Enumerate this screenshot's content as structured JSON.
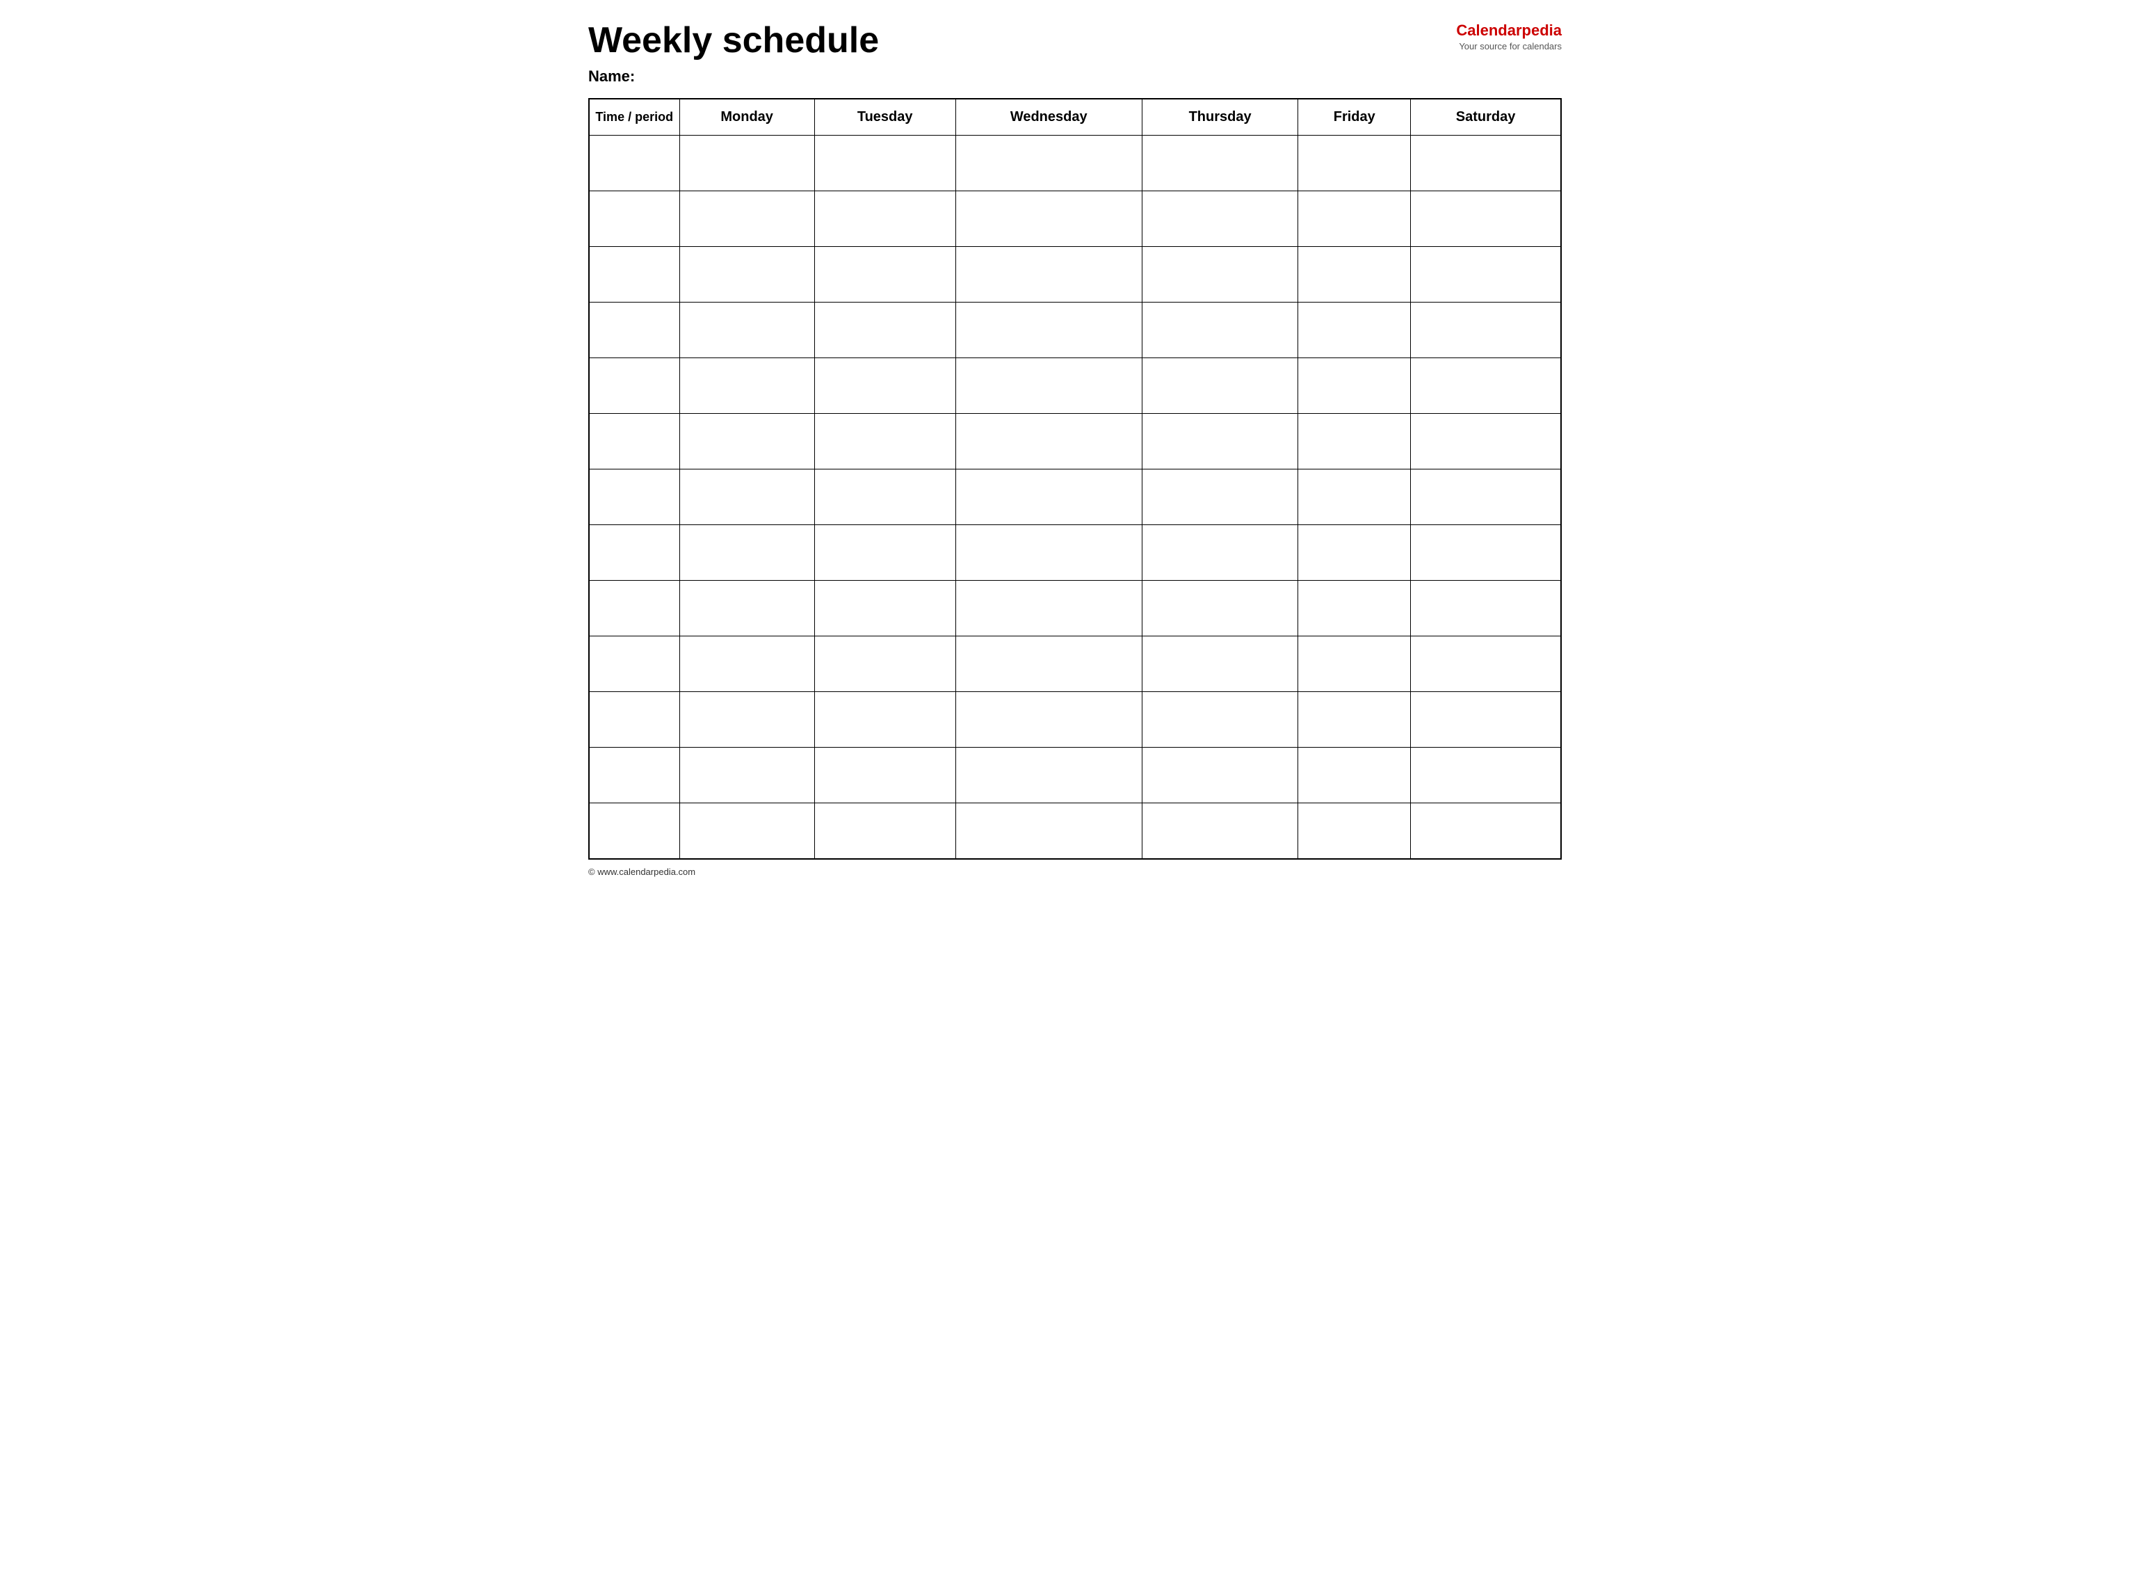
{
  "header": {
    "title": "Weekly schedule",
    "logo_brand": "Calendar",
    "logo_brand_accent": "pedia",
    "logo_tagline": "Your source for calendars"
  },
  "name_label": "Name:",
  "columns": [
    "Time / period",
    "Monday",
    "Tuesday",
    "Wednesday",
    "Thursday",
    "Friday",
    "Saturday"
  ],
  "rows": 13,
  "footer": "© www.calendarpedia.com"
}
